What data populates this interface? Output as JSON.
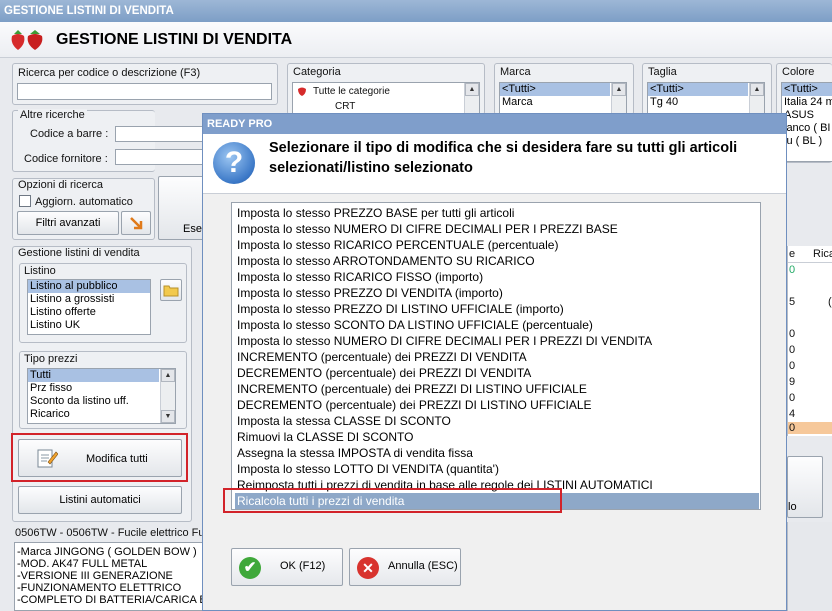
{
  "window": {
    "title": "GESTIONE LISTINI DI VENDITA"
  },
  "header": {
    "title": "GESTIONE LISTINI DI VENDITA"
  },
  "search": {
    "label": "Ricerca per codice o descrizione (F3)",
    "value": "",
    "other_label": "Altre ricerche",
    "barcode_label": "Codice a barre :",
    "supplier_code_label": "Codice fornitore :"
  },
  "search_options": {
    "label": "Opzioni di ricerca",
    "auto_update": "Aggiorn. automatico",
    "advanced_filters": "Filtri avanzati",
    "execute_partial": "Ese"
  },
  "filters": {
    "category": {
      "label": "Categoria",
      "items": [
        "Tutte le categorie",
        "CRT"
      ]
    },
    "brand": {
      "label": "Marca",
      "items": [
        "<Tutti>",
        "Marca"
      ]
    },
    "size": {
      "label": "Taglia",
      "items": [
        "<Tutti>",
        "Tg 40"
      ]
    },
    "color": {
      "label": "Colore",
      "items": [
        "<Tutti>",
        "Italia 24 m",
        "ASUS",
        "ianco ( BI",
        "lu ( BL )"
      ]
    }
  },
  "pricelists": {
    "group_label": "Gestione listini di vendita",
    "list_label": "Listino",
    "items": [
      "Listino al pubblico",
      "Listino a grossisti",
      "Listino offerte",
      "Listino UK"
    ],
    "price_type_label": "Tipo prezzi",
    "price_types": [
      "Tutti",
      "Prz fisso",
      "Sconto da listino uff.",
      "Ricarico"
    ],
    "modify_all": "Modifica tutti",
    "auto_lists": "Listini automatici"
  },
  "grid_partial": {
    "header": [
      "e",
      "Rica"
    ],
    "cells": [
      "0",
      "5",
      "0",
      "0",
      "0",
      "9",
      "0",
      "0",
      "4",
      "0",
      "0",
      "(",
      "o",
      "lo"
    ]
  },
  "article": {
    "title": "0506TW - 0506TW  - Fucile elettrico Fu",
    "lines": [
      "-Marca JINGONG ( GOLDEN BOW )",
      "-MOD. AK47 FULL METAL",
      "-VERSIONE III GENERAZIONE",
      "-FUNZIONAMENTO ELETTRICO",
      "-COMPLETO DI BATTERIA/CARICA BAT"
    ]
  },
  "dialog": {
    "title": "READY PRO",
    "message": "Selezionare il tipo di modifica che si desidera fare su tutti gli articoli selezionati/listino selezionato",
    "options": [
      "Imposta lo stesso PREZZO BASE per tutti gli articoli",
      "Imposta lo stesso NUMERO DI CIFRE DECIMALI PER I PREZZI BASE",
      "Imposta lo stesso RICARICO PERCENTUALE (percentuale)",
      "Imposta lo stesso ARROTONDAMENTO SU RICARICO",
      "Imposta lo stesso RICARICO FISSO (importo)",
      "Imposta lo stesso PREZZO DI VENDITA (importo)",
      "Imposta lo stesso PREZZO DI LISTINO UFFICIALE (importo)",
      "Imposta lo stesso SCONTO DA LISTINO UFFICIALE (percentuale)",
      "Imposta lo stesso NUMERO DI CIFRE DECIMALI PER I PREZZI DI VENDITA",
      "INCREMENTO (percentuale) dei PREZZI DI VENDITA",
      "DECREMENTO (percentuale) dei PREZZI DI VENDITA",
      "INCREMENTO (percentuale) dei PREZZI DI LISTINO UFFICIALE",
      "DECREMENTO (percentuale) dei PREZZI DI LISTINO UFFICIALE",
      "Imposta la stessa CLASSE DI SCONTO",
      "Rimuovi la CLASSE DI SCONTO",
      "Assegna la stessa IMPOSTA di vendita fissa",
      "Imposta lo stesso LOTTO DI VENDITA (quantita')",
      "Reimposta tutti i prezzi di vendita in base alle regole dei LISTINI AUTOMATICI",
      "Ricalcola tutti i prezzi di vendita"
    ],
    "selected_index": 18,
    "ok_label": "OK (F12)",
    "cancel_label": "Annulla (ESC)"
  },
  "colors": {
    "accent": "#7f9ecb",
    "selection": "#8ea8c8",
    "highlight": "#d2232a"
  }
}
